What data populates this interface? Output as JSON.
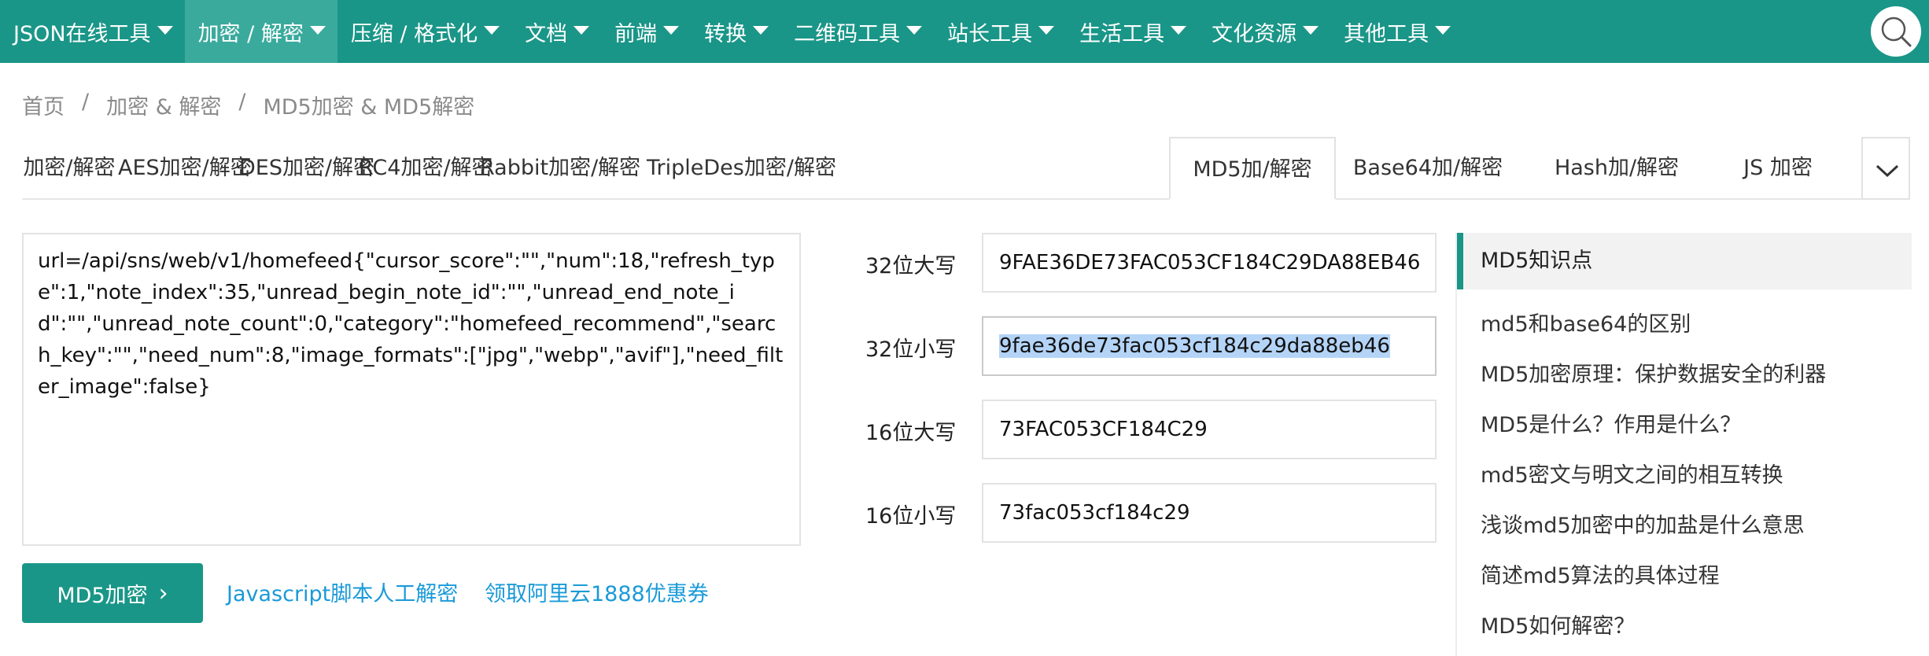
{
  "nav": {
    "items": [
      {
        "label": "JSON在线工具"
      },
      {
        "label": "加密 / 解密"
      },
      {
        "label": "压缩 / 格式化"
      },
      {
        "label": "文档"
      },
      {
        "label": "前端"
      },
      {
        "label": "转换"
      },
      {
        "label": "二维码工具"
      },
      {
        "label": "站长工具"
      },
      {
        "label": "生活工具"
      },
      {
        "label": "文化资源"
      },
      {
        "label": "其他工具"
      }
    ],
    "active_index": 1,
    "search_icon": "search-icon",
    "accent": "#1a9688"
  },
  "breadcrumb": {
    "items": [
      "首页",
      "加密 & 解密",
      "MD5加密 & MD5解密"
    ],
    "separator": "/"
  },
  "tabs": {
    "items": [
      "加密/解密",
      "AES加密/解密",
      "DES加密/解密",
      "RC4加密/解密",
      "Rabbit加密/解密",
      "TripleDes加密/解密",
      "MD5加/解密",
      "Base64加/解密",
      "Hash加/解密",
      "JS 加密"
    ],
    "active": "MD5加/解密",
    "more_icon": "chevron-down-icon"
  },
  "input": {
    "value": "url=/api/sns/web/v1/homefeed{\"cursor_score\":\"\",\"num\":18,\"refresh_type\":1,\"note_index\":35,\"unread_begin_note_id\":\"\",\"unread_end_note_id\":\"\",\"unread_note_count\":0,\"category\":\"homefeed_recommend\",\"search_key\":\"\",\"need_num\":8,\"image_formats\":[\"jpg\",\"webp\",\"avif\"],\"need_filter_image\":false}"
  },
  "actions": {
    "encrypt_label": "MD5加密",
    "link_js": "Javascript脚本人工解密",
    "link_coupon": "领取阿里云1888优惠券"
  },
  "results": [
    {
      "label": "32位大写",
      "value": "9FAE36DE73FAC053CF184C29DA88EB46"
    },
    {
      "label": "32位小写",
      "value": "9fae36de73fac053cf184c29da88eb46"
    },
    {
      "label": "16位大写",
      "value": "73FAC053CF184C29"
    },
    {
      "label": "16位小写",
      "value": "73fac053cf184c29"
    }
  ],
  "sidebar": {
    "title": "MD5知识点",
    "links": [
      "md5和base64的区别",
      "MD5加密原理：保护数据安全的利器",
      "MD5是什么？作用是什么？",
      "md5密文与明文之间的相互转换",
      "浅谈md5加密中的加盐是什么意思",
      "简述md5算法的具体过程",
      "MD5如何解密？"
    ]
  }
}
